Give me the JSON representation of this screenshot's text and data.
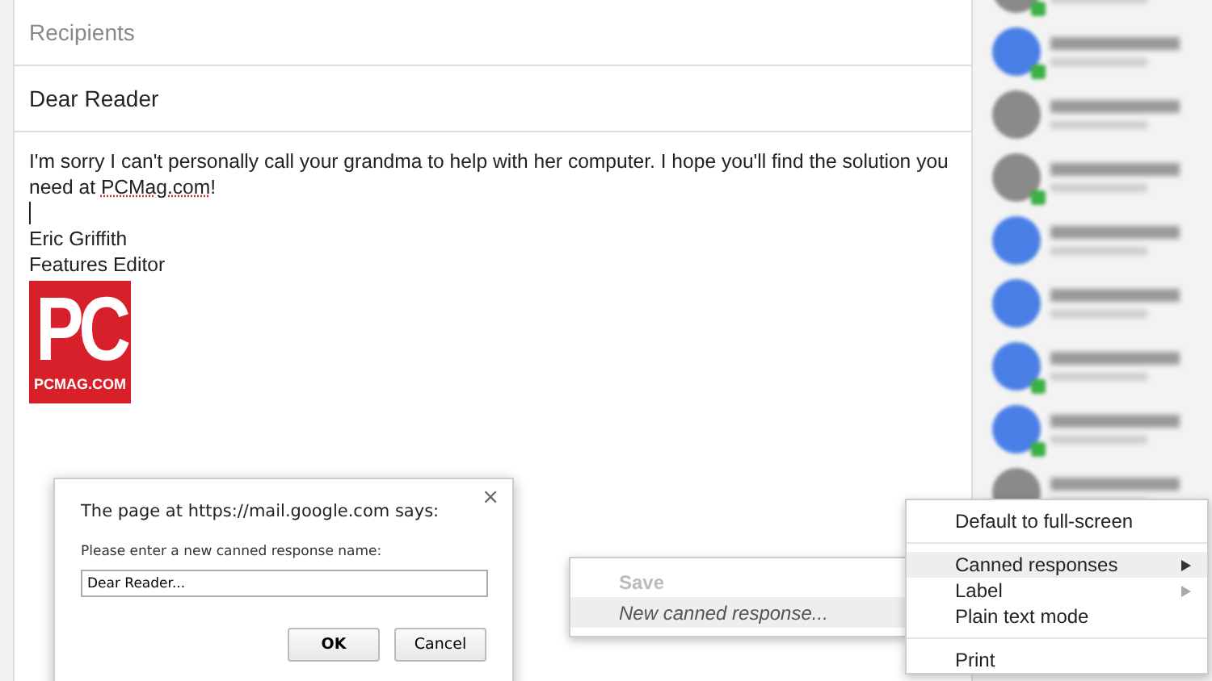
{
  "compose": {
    "recipients_placeholder": "Recipients",
    "subject": "Dear Reader",
    "body": {
      "paragraph": "I'm sorry I can't personally call your grandma to help with her computer.  I hope you'll find the solution you need at ",
      "link": "PCMag.com",
      "after_link": "!",
      "signature": [
        "Eric Griffith",
        "Features Editor"
      ],
      "logo": {
        "letters": "PC",
        "site": "PCMAG.COM"
      }
    }
  },
  "contacts": [
    {
      "kind": "photo",
      "online": true
    },
    {
      "kind": "generic",
      "online": true
    },
    {
      "kind": "photo",
      "online": false
    },
    {
      "kind": "photo",
      "online": true
    },
    {
      "kind": "generic",
      "online": false
    },
    {
      "kind": "generic",
      "online": false
    },
    {
      "kind": "generic",
      "online": true
    },
    {
      "kind": "generic",
      "online": true
    },
    {
      "kind": "photo",
      "online": false
    }
  ],
  "dialog": {
    "title": "The page at https://mail.google.com says:",
    "close": "×",
    "prompt": "Please enter a new canned response name:",
    "value": "Dear Reader...",
    "buttons": [
      {
        "label": "OK",
        "default": true
      },
      {
        "label": "Cancel",
        "default": false
      }
    ]
  },
  "submenu": [
    {
      "label": "Save",
      "disabled": true,
      "selected": false
    },
    {
      "label": "New canned response...",
      "disabled": false,
      "selected": true
    }
  ],
  "menu": [
    {
      "kind": "item",
      "label": "Default to full-screen",
      "submenu": false,
      "selected": false
    },
    {
      "kind": "divider"
    },
    {
      "kind": "item",
      "label": "Canned responses",
      "submenu": true,
      "selected": true
    },
    {
      "kind": "item",
      "label": "Label",
      "submenu": true,
      "selected": false
    },
    {
      "kind": "item",
      "label": "Plain text mode",
      "submenu": false,
      "selected": false
    },
    {
      "kind": "divider"
    },
    {
      "kind": "item",
      "label": "Print",
      "submenu": false,
      "selected": false
    }
  ]
}
